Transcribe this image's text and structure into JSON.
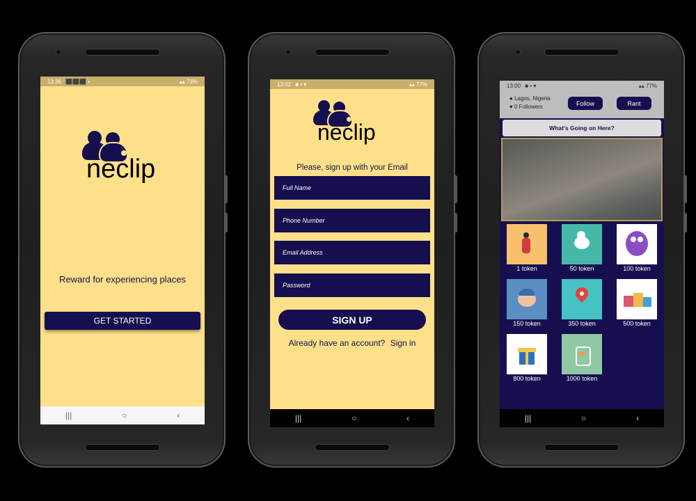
{
  "screen1": {
    "status_time": "13:36",
    "status_icons": "⬛⬛⬛ •",
    "status_right": "73%",
    "logo_word": "neclip",
    "tagline": "Reward for experiencing places",
    "get_started_label": "GET STARTED",
    "nav": {
      "recent": "|||",
      "home": "○",
      "back": "‹"
    }
  },
  "screen2": {
    "status_time": "13:02",
    "status_right": "77%",
    "logo_word": "neclip",
    "prompt": "Please, sign up with your Email",
    "fields": {
      "full_name": "Full Name",
      "phone": "Phone Number",
      "email": "Email Address",
      "password": "Password"
    },
    "signup_label": "SIGN UP",
    "already_text": "Already have an account?",
    "signin_link": "Sign in",
    "nav": {
      "recent": "|||",
      "home": "○",
      "back": "‹"
    }
  },
  "screen3": {
    "status_time": "13:00",
    "status_right": "77%",
    "location": "Lagos, Nigeria",
    "followers": "0 Followers",
    "follow_label": "Follow",
    "rant_label": "Rant",
    "whats_going_label": "What's Going on Here?",
    "tokens": [
      "1 token",
      "50 token",
      "100 token",
      "150 token",
      "350 token",
      "500 token",
      "800 token",
      "1000 token"
    ],
    "nav": {
      "recent": "|||",
      "home": "○",
      "back": "‹"
    }
  },
  "colors": {
    "brand_navy": "#150f4f",
    "brand_yellow": "#ffe08a"
  }
}
